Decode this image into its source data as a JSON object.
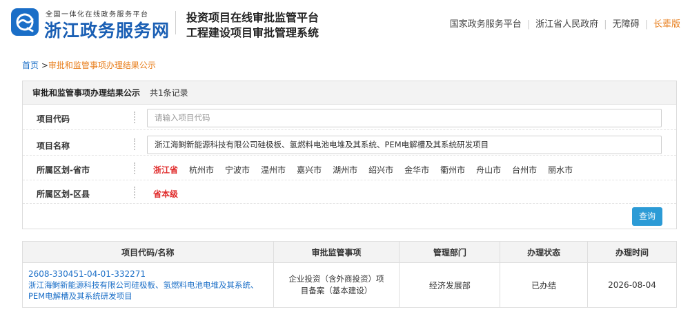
{
  "header": {
    "logo_small": "全国一体化在线政务服务平台",
    "logo_big": "浙江政务服务网",
    "title_line1": "投资项目在线审批监管平台",
    "title_line2": "工程建设项目审批管理系统",
    "links": [
      "国家政务服务平台",
      "浙江省人民政府",
      "无障碍"
    ],
    "elder_link": "长辈版"
  },
  "breadcrumb": {
    "home": "首页",
    "separator": ">",
    "current": "审批和监管事项办理结果公示"
  },
  "panel": {
    "title": "审批和监管事项办理结果公示",
    "record_count": "共1条记录",
    "project_code": {
      "label": "项目代码",
      "placeholder": "请输入项目代码"
    },
    "project_name": {
      "label": "项目名称",
      "value": "浙江海鲥新能源科技有限公司硅极板、氢燃料电池电堆及其系统、PEM电解槽及其系统研发项目"
    },
    "region_city": {
      "label": "所属区划-省市",
      "options": [
        "浙江省",
        "杭州市",
        "宁波市",
        "温州市",
        "嘉兴市",
        "湖州市",
        "绍兴市",
        "金华市",
        "衢州市",
        "舟山市",
        "台州市",
        "丽水市"
      ],
      "selected": "浙江省"
    },
    "region_county": {
      "label": "所属区划-区县",
      "selected": "省本级"
    },
    "query_label": "查询"
  },
  "table": {
    "headers": [
      "项目代码/名称",
      "审批监管事项",
      "管理部门",
      "办理状态",
      "办理时间"
    ],
    "rows": [
      {
        "code": "2608-330451-04-01-332271",
        "name": "浙江海鲥新能源科技有限公司硅极板、氢燃料电池电堆及其系统、PEM电解槽及其系统研发项目",
        "matter": "企业投资（含外商投资）项目备案（基本建设）",
        "department": "经济发展部",
        "status": "已办结",
        "date": "2026-08-04"
      }
    ]
  },
  "colors": {
    "brand_blue": "#1a6ec7",
    "accent_orange": "#e87f1e",
    "active_red": "#e02b2b",
    "button_blue": "#2c9bd6"
  }
}
